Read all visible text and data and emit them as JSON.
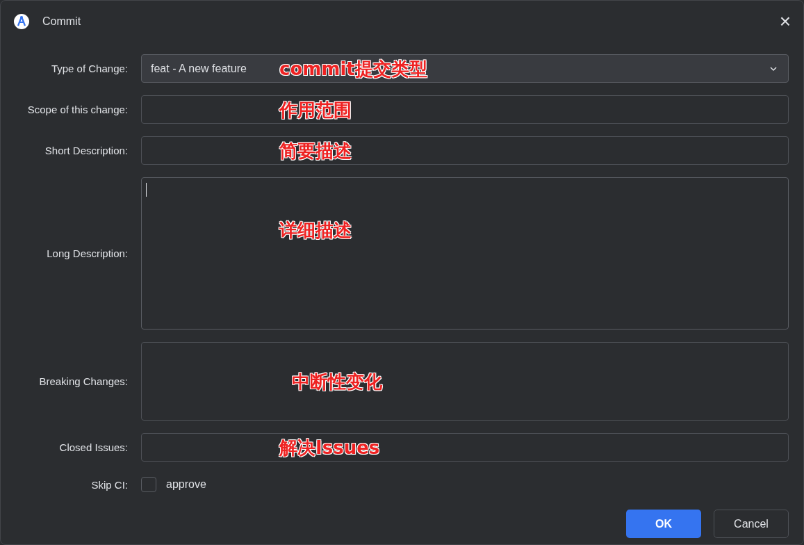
{
  "window": {
    "title": "Commit",
    "close": "×"
  },
  "fields": [
    {
      "kind": "dropdown",
      "label": "Type of Change:",
      "value": "feat - A new feature",
      "annotation": "commit提交类型"
    },
    {
      "kind": "text",
      "label": "Scope of this change:",
      "annotation": "作用范围"
    },
    {
      "kind": "text",
      "label": "Short Description:",
      "annotation": "简要描述"
    },
    {
      "kind": "textarea",
      "label": "Long Description:",
      "focused": true,
      "annotation": "详细描述"
    },
    {
      "kind": "textarea",
      "label": "Breaking Changes:",
      "focused": false,
      "annotation": "中断性变化"
    },
    {
      "kind": "text",
      "label": "Closed Issues:",
      "annotation": "解决Issues"
    },
    {
      "kind": "checkbox",
      "label": "Skip CI:",
      "text": "approve",
      "checked": false
    }
  ],
  "buttons": [
    {
      "label": "OK",
      "primary": true
    },
    {
      "label": "Cancel",
      "primary": false
    }
  ]
}
